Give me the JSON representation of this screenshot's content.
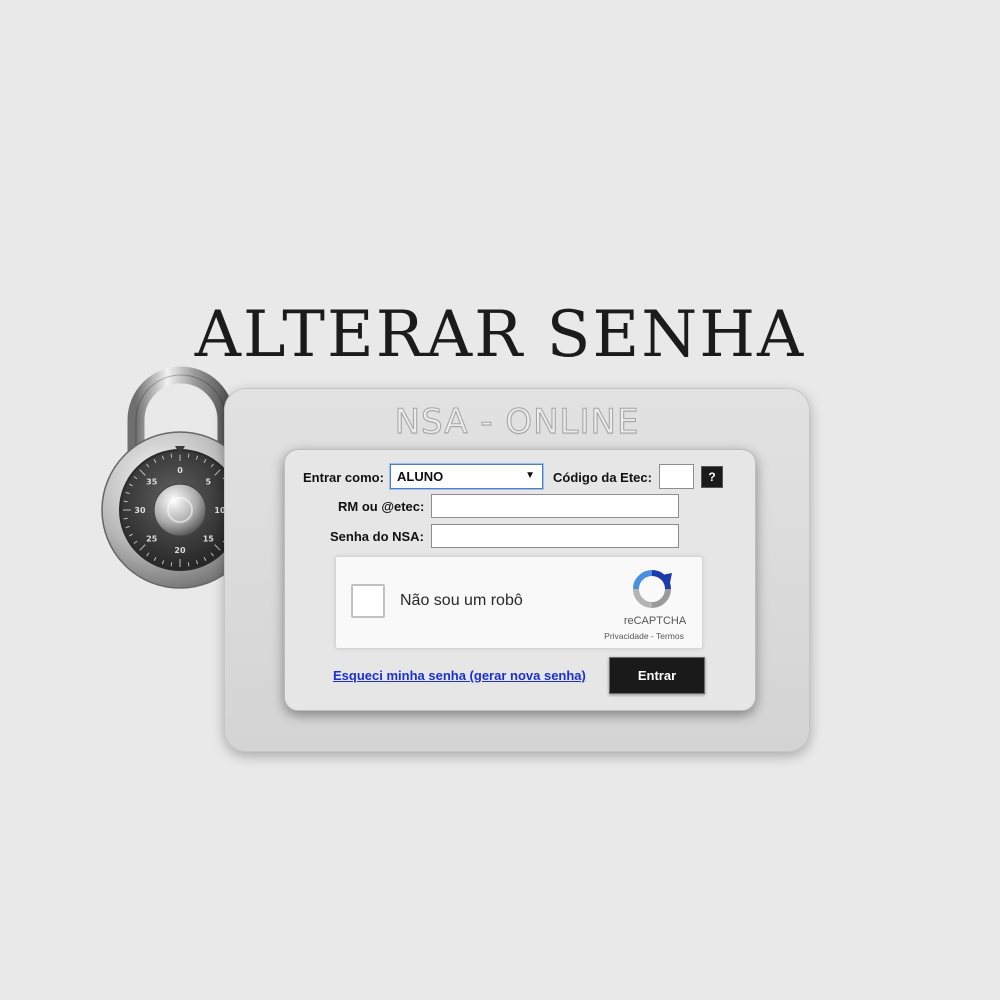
{
  "page": {
    "title": "ALTERAR SENHA",
    "brand": "NSA - ONLINE"
  },
  "form": {
    "role_label": "Entrar como:",
    "role_selected": "ALUNO",
    "etec_code_label": "Código da Etec:",
    "etec_code_value": "",
    "help_label": "?",
    "rm_label": "RM ou @etec:",
    "rm_value": "",
    "password_label": "Senha do NSA:",
    "password_value": "",
    "forgot_link": "Esqueci minha senha (gerar nova senha)",
    "submit_label": "Entrar"
  },
  "captcha": {
    "checkbox_label": "Não sou um robô",
    "brand": "reCAPTCHA",
    "links": "Privacidade - Termos",
    "checked": false
  },
  "lock": {
    "dial_numbers": [
      "0",
      "5",
      "10",
      "15",
      "20",
      "25",
      "30",
      "35"
    ]
  },
  "colors": {
    "background": "#e9e9e9",
    "link": "#1a2fd6",
    "button": "#1a1a1a",
    "focus_border": "#4d7ec4"
  }
}
